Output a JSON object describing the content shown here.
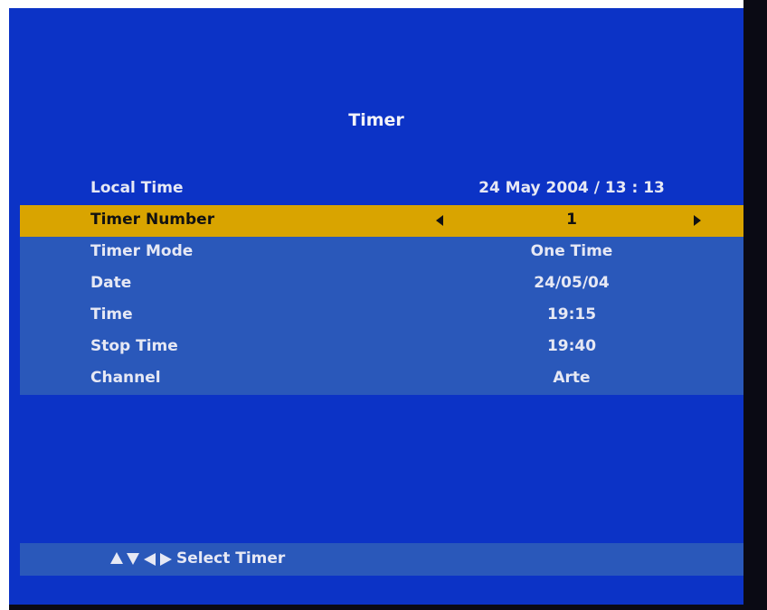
{
  "screen": {
    "title": "Timer"
  },
  "local_time": {
    "label": "Local Time",
    "value": "24 May 2004 / 13 : 13"
  },
  "rows": [
    {
      "label": "Timer Number",
      "value": "1",
      "selected": true
    },
    {
      "label": "Timer Mode",
      "value": "One Time"
    },
    {
      "label": "Date",
      "value": "24/05/04"
    },
    {
      "label": "Time",
      "value": "19:15"
    },
    {
      "label": "Stop Time",
      "value": "19:40"
    },
    {
      "label": "Channel",
      "value": "Arte"
    }
  ],
  "footer": {
    "hint": "Select Timer",
    "icons": [
      "up-arrow-icon",
      "down-arrow-icon",
      "left-arrow-icon",
      "right-arrow-icon"
    ]
  },
  "colors": {
    "background": "#0c33c6",
    "panel": "#2a58ba",
    "highlight": "#d9a400",
    "text": "#e6e8f4"
  }
}
